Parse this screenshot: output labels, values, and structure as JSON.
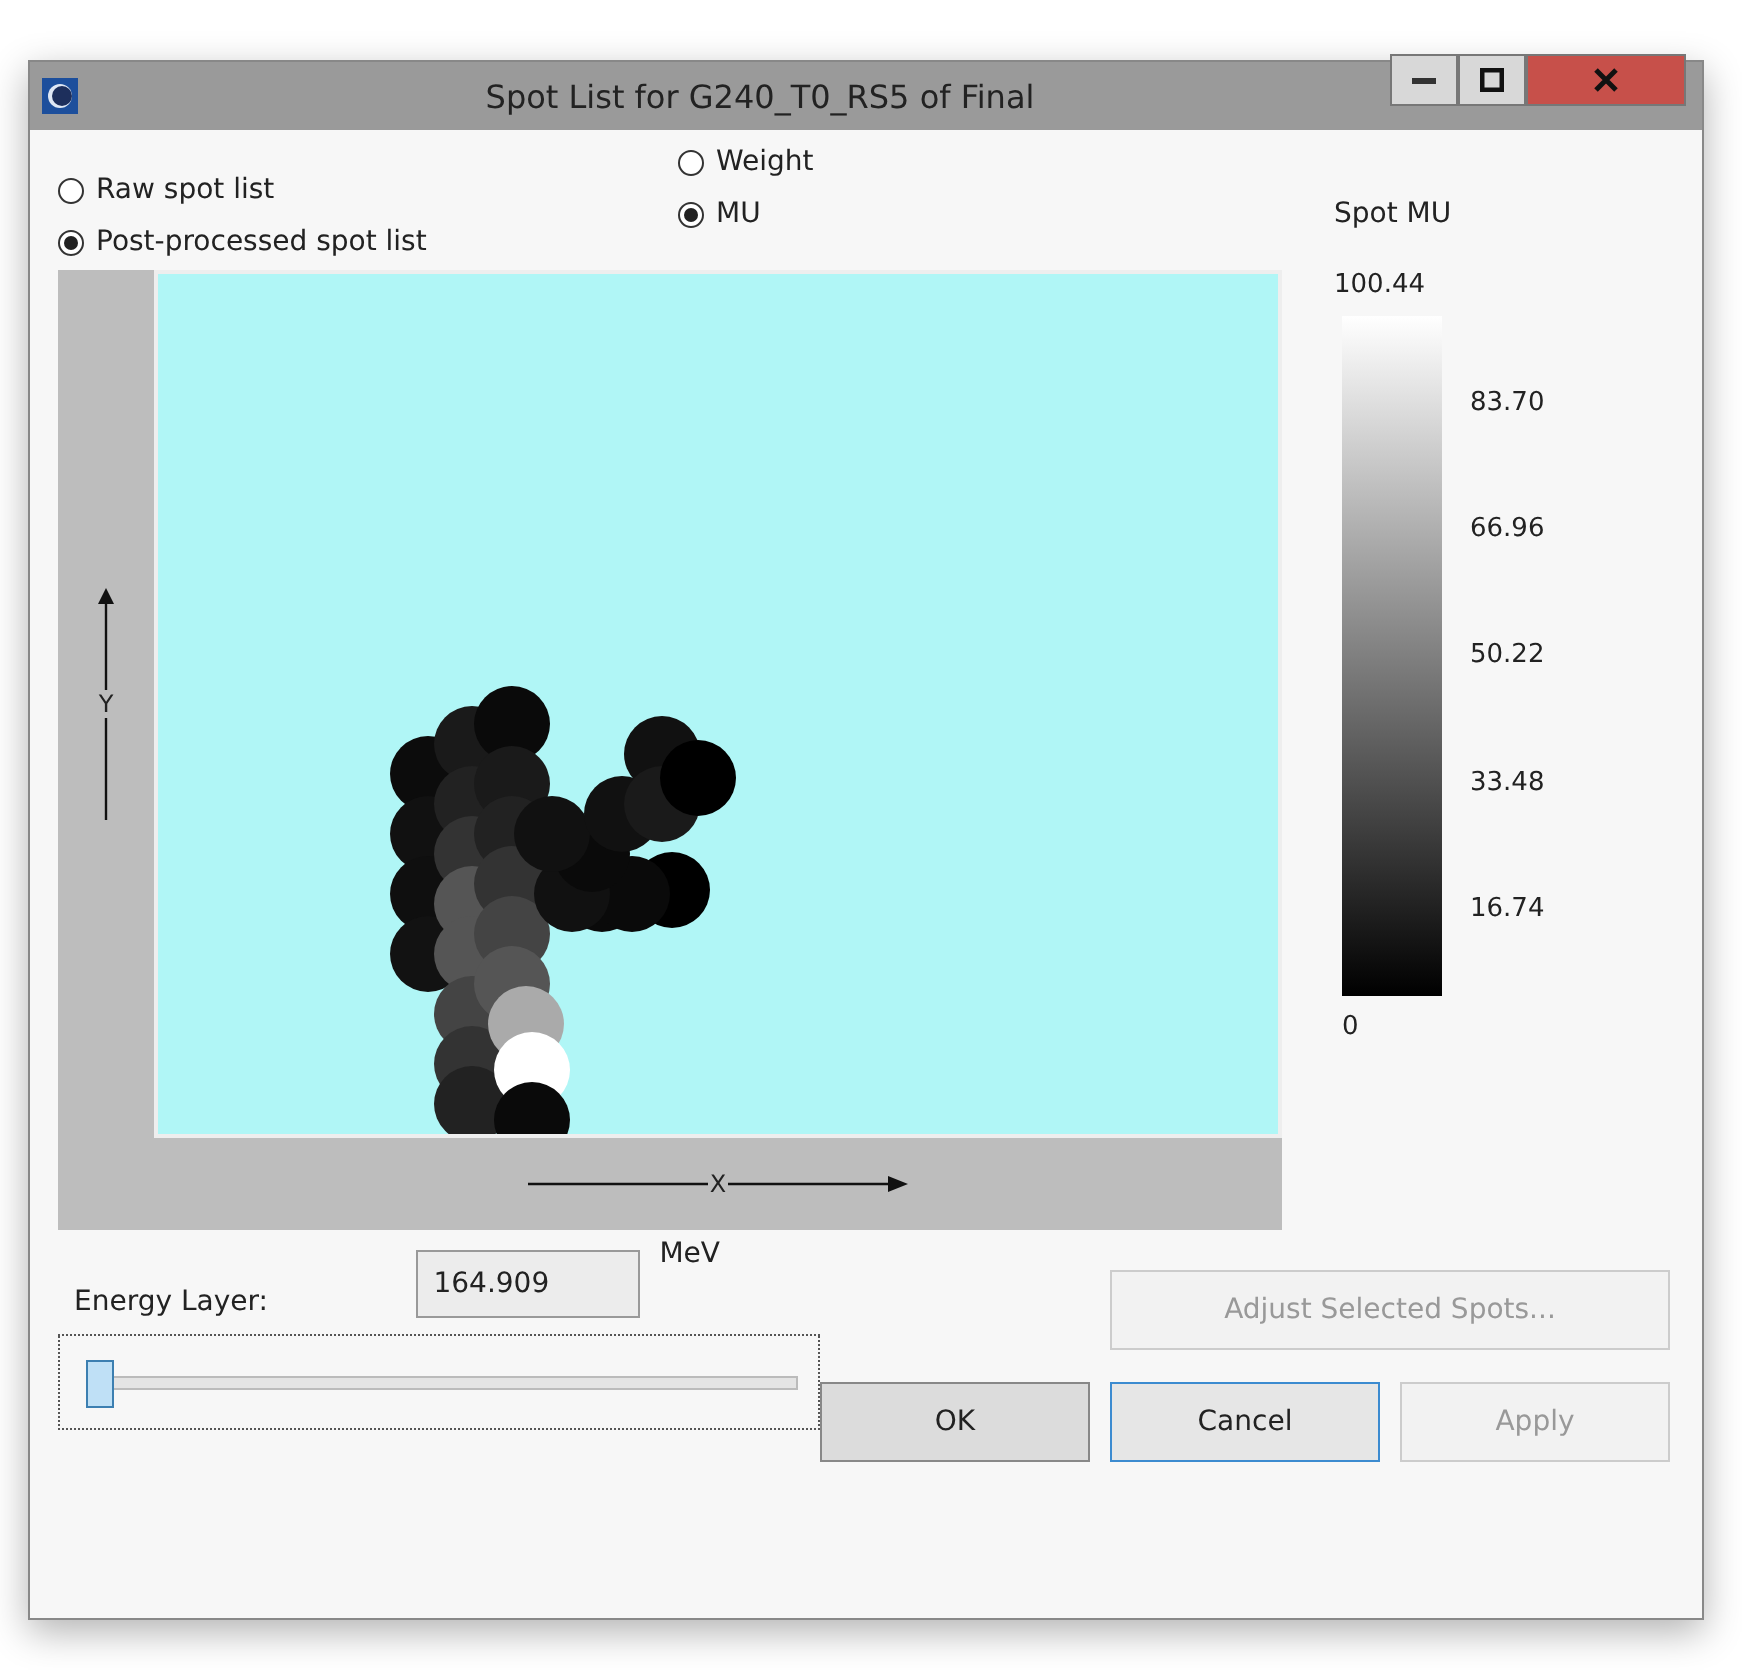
{
  "window": {
    "title": "Spot List for G240_T0_RS5 of Final"
  },
  "list_options": [
    {
      "label": "Raw spot list",
      "selected": false
    },
    {
      "label": "Post-processed spot list",
      "selected": true
    }
  ],
  "display_options": [
    {
      "label": "Weight",
      "selected": false
    },
    {
      "label": "MU",
      "selected": true
    }
  ],
  "plot": {
    "y_axis_label": "Y",
    "x_axis_label": "X"
  },
  "color_scale": {
    "title": "Spot MU",
    "labels": [
      "100.44",
      "83.70",
      "66.96",
      "50.22",
      "33.48",
      "16.74",
      "0"
    ]
  },
  "energy_layer": {
    "label": "Energy Layer:",
    "value": "164.909",
    "unit": "MeV",
    "level": 0
  },
  "adjust_button": {
    "label": "Adjust Selected Spots...",
    "disabled": true
  },
  "buttons": [
    {
      "label": "OK",
      "disabled": false,
      "focused": false
    },
    {
      "label": "Cancel",
      "disabled": false,
      "focused": true
    },
    {
      "label": "Apply",
      "disabled": true,
      "focused": false
    }
  ]
}
